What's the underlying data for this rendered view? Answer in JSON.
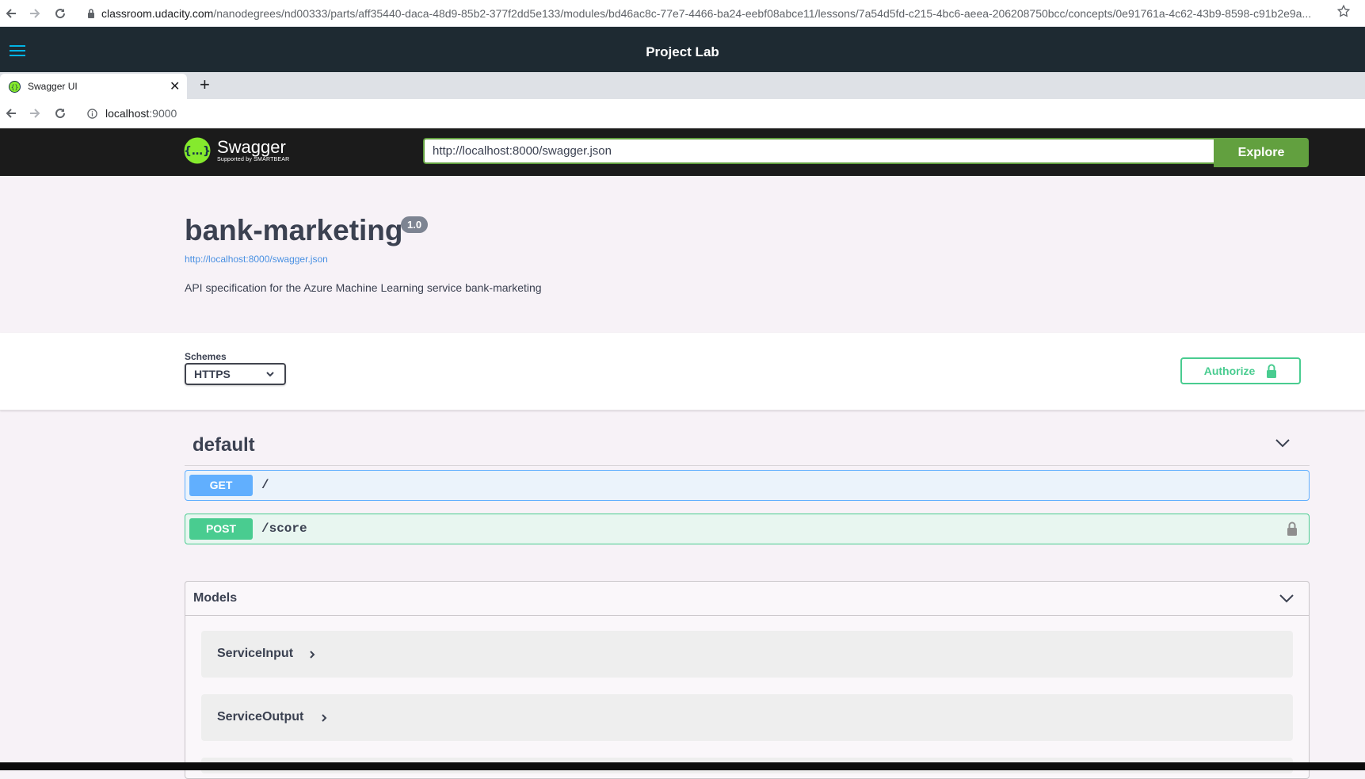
{
  "outer_browser": {
    "url_host": "classroom.udacity.com",
    "url_path": "/nanodegrees/nd00333/parts/aff35440-daca-48d9-85b2-377f2dd5e133/modules/bd46ac8c-77e7-4466-ba24-eebf08abce11/lessons/7a54d5fd-c215-4bc6-aeea-206208750bcc/concepts/0e91761a-4c62-43b9-8598-c91b2e9a..."
  },
  "udacity_header": {
    "title": "Project Lab"
  },
  "inner_browser": {
    "tab_title": "Swagger UI",
    "url_host": "localhost",
    "url_port": ":9000"
  },
  "swagger_bar": {
    "brand": "Swagger",
    "brand_sub": "Supported by SMARTBEAR",
    "spec_url": "http://localhost:8000/swagger.json",
    "explore_label": "Explore"
  },
  "info": {
    "title": "bank-marketing",
    "version": "1.0",
    "link": "http://localhost:8000/swagger.json",
    "description": "API specification for the Azure Machine Learning service bank-marketing"
  },
  "schemes": {
    "label": "Schemes",
    "selected": "HTTPS",
    "authorize_label": "Authorize"
  },
  "operations": {
    "tag": "default",
    "items": [
      {
        "method": "GET",
        "path": "/"
      },
      {
        "method": "POST",
        "path": "/score",
        "locked": true
      }
    ]
  },
  "models": {
    "title": "Models",
    "items": [
      "ServiceInput",
      "ServiceOutput"
    ]
  },
  "colors": {
    "swagger_green": "#62a03f",
    "get_blue": "#61affe",
    "post_green": "#49cc90",
    "udacity_header": "#1e2a32"
  }
}
